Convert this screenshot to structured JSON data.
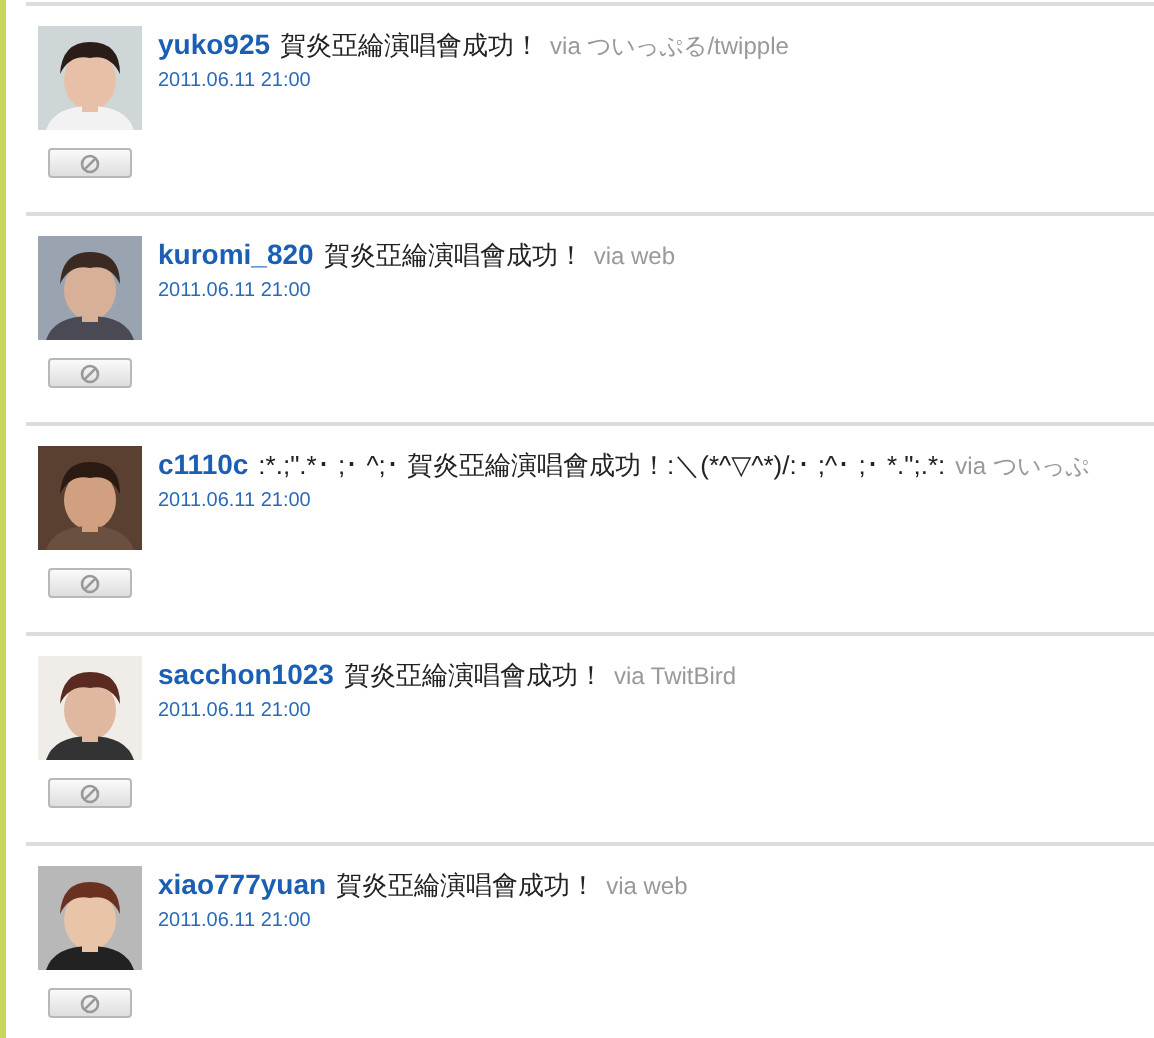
{
  "tweets": [
    {
      "user": "yuko925",
      "text": "賀炎亞綸演唱會成功！",
      "via": "via ついっぷる/twipple",
      "time": "2011.06.11 21:00"
    },
    {
      "user": "kuromi_820",
      "text": "賀炎亞綸演唱會成功！",
      "via": "via web",
      "time": "2011.06.11 21:00"
    },
    {
      "user": "c1110c",
      "text": ":*.;\".*･ ;･ ^;･ 賀炎亞綸演唱會成功！:＼(*^▽^*)/:･ ;^･ ;･ *.\";.*:",
      "via": "via ついっぷ",
      "time": "2011.06.11 21:00"
    },
    {
      "user": "sacchon1023",
      "text": "賀炎亞綸演唱會成功！",
      "via": "via TwitBird",
      "time": "2011.06.11 21:00"
    },
    {
      "user": "xiao777yuan",
      "text": "賀炎亞綸演唱會成功！",
      "via": "via web",
      "time": "2011.06.11 21:00"
    }
  ]
}
